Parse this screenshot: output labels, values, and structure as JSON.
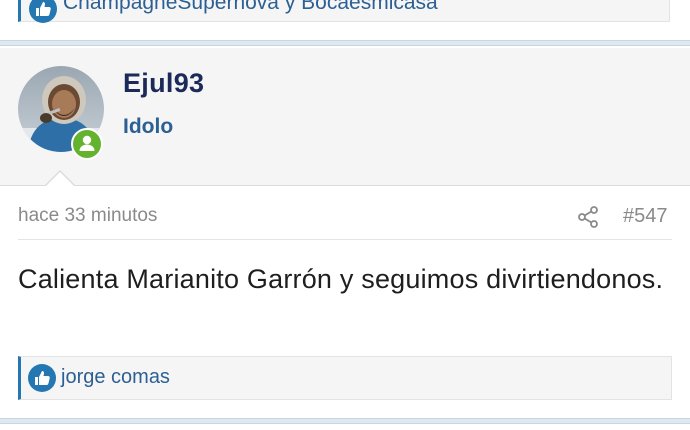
{
  "previous_post": {
    "reactions_text": "ChampagneSupernova y Bocaesmicasa"
  },
  "post": {
    "author": {
      "username": "Ejul93",
      "title": "Idolo",
      "online": true
    },
    "time": "hace 33 minutos",
    "number": "#547",
    "body": "Calienta Marianito Garrón y seguimos divirtiendonos.",
    "reactions_text": "jorge comas"
  },
  "icons": {
    "like": "thumbs-up-icon",
    "share": "share-icon",
    "online": "user-online-icon"
  },
  "colors": {
    "link": "#2c5f93",
    "username": "#1b2a58",
    "online_badge": "#63b32e",
    "like_icon": "#2577b1",
    "separator": "#dfe8f1"
  }
}
